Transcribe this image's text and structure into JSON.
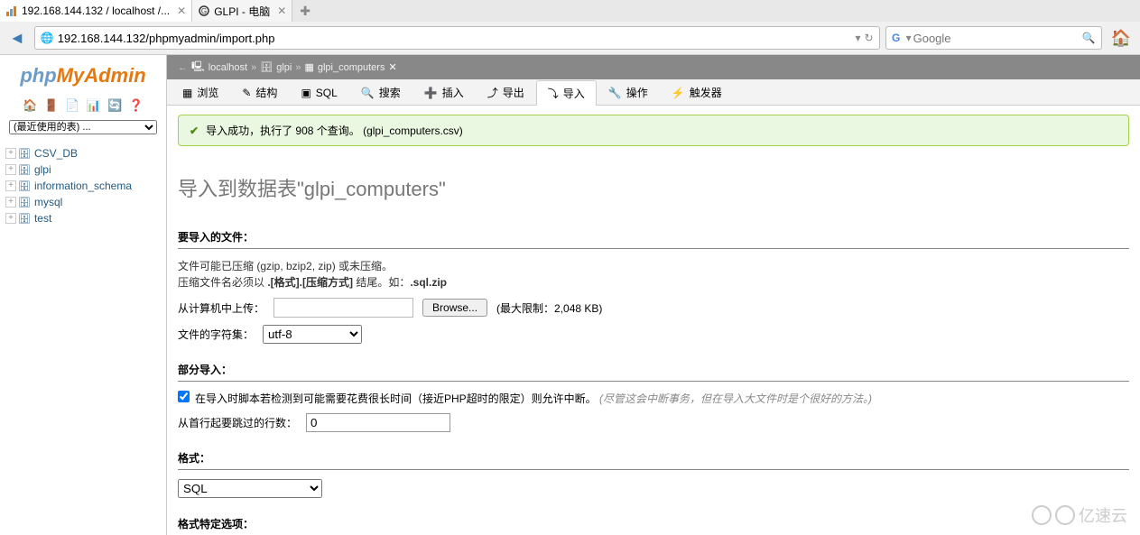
{
  "browser": {
    "tabs": [
      {
        "label": "192.168.144.132 / localhost /...",
        "active": true
      },
      {
        "label": "GLPI - 电脑",
        "active": false
      }
    ],
    "url": "192.168.144.132/phpmyadmin/import.php",
    "search_placeholder": "Google"
  },
  "sidebar": {
    "recent_label": "(最近使用的表) ...",
    "databases": [
      "CSV_DB",
      "glpi",
      "information_schema",
      "mysql",
      "test"
    ]
  },
  "breadcrumb": {
    "items": [
      "localhost",
      "glpi",
      "glpi_computers"
    ]
  },
  "tabs": [
    {
      "label": "浏览",
      "ico": "▦"
    },
    {
      "label": "结构",
      "ico": "✎"
    },
    {
      "label": "SQL",
      "ico": "▣"
    },
    {
      "label": "搜索",
      "ico": "🔍"
    },
    {
      "label": "插入",
      "ico": "➕"
    },
    {
      "label": "导出",
      "ico": "⤴"
    },
    {
      "label": "导入",
      "ico": "⤵",
      "active": true
    },
    {
      "label": "操作",
      "ico": "🔧"
    },
    {
      "label": "触发器",
      "ico": "⚡"
    }
  ],
  "success": "导入成功，执行了 908 个查询。 (glpi_computers.csv)",
  "title": "导入到数据表\"glpi_computers\"",
  "file_section": {
    "heading": "要导入的文件：",
    "note1": "文件可能已压缩 (gzip, bzip2, zip) 或未压缩。",
    "note2_prefix": "压缩文件名必须以 ",
    "note2_bold": ".[格式].[压缩方式]",
    "note2_suffix": " 结尾。如：",
    "note2_example": ".sql.zip",
    "upload_label": "从计算机中上传：",
    "browse": "Browse...",
    "limit": "(最大限制：2,048 KB)",
    "charset_label": "文件的字符集：",
    "charset_value": "utf-8"
  },
  "partial_section": {
    "heading": "部分导入：",
    "checkbox_text": "在导入时脚本若检测到可能需要花费很长时间（接近PHP超时的限定）则允许中断。",
    "checkbox_hint": "(尽管这会中断事务，但在导入大文件时是个很好的方法。)",
    "skip_label": "从首行起要跳过的行数：",
    "skip_value": "0"
  },
  "format_section": {
    "heading": "格式：",
    "value": "SQL",
    "options_heading": "格式特定选项："
  },
  "watermark": "亿速云"
}
